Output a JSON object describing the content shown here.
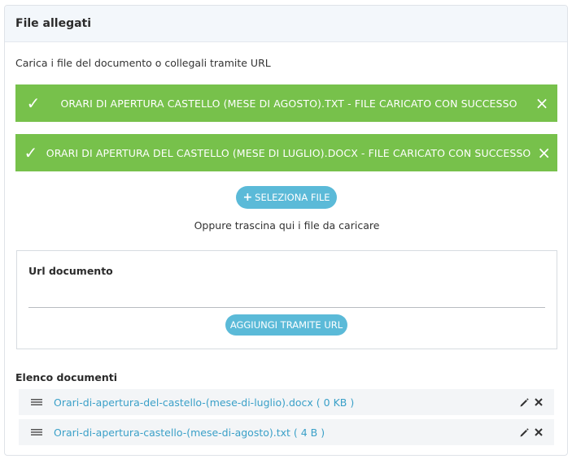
{
  "panel": {
    "title": "File allegati"
  },
  "intro": "Carica i file del documento o collegali tramite URL",
  "alerts": [
    {
      "message": "ORARI DI APERTURA CASTELLO (MESE DI AGOSTO).TXT - FILE CARICATO CON SUCCESSO",
      "check": "✓",
      "close": "×"
    },
    {
      "message": "ORARI DI APERTURA DEL CASTELLO (MESE DI LUGLIO).DOCX - FILE CARICATO CON SUCCESSO",
      "check": "✓",
      "close": "×"
    }
  ],
  "upload": {
    "select_label": "SELEZIONA FILE",
    "select_icon": "+",
    "drop_hint": "Oppure trascina qui i file da caricare"
  },
  "url_section": {
    "label": "Url documento",
    "value": "",
    "placeholder": "",
    "add_label": "AGGIUNGI TRAMITE URL"
  },
  "documents": {
    "title": "Elenco documenti",
    "items": [
      {
        "name": "Orari-di-apertura-del-castello-(mese-di-luglio).docx ( 0 KB )"
      },
      {
        "name": "Orari-di-apertura-castello-(mese-di-agosto).txt ( 4 B )"
      }
    ]
  },
  "colors": {
    "success": "#77c14b",
    "button": "#5bbad8",
    "link": "#3aa0c8",
    "header_bg": "#f3f7fb",
    "row_bg": "#f3f5f7"
  },
  "icons": [
    "check-icon",
    "close-icon",
    "plus-icon",
    "drag-handle-icon",
    "edit-icon",
    "remove-icon"
  ]
}
